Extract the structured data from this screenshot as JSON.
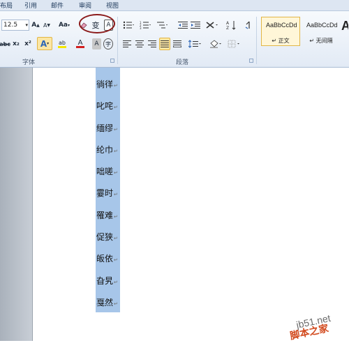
{
  "ribbon_tabs": [
    "布局",
    "引用",
    "邮件",
    "审阅",
    "视图"
  ],
  "font": {
    "size_value": "12.5",
    "grow_label": "A",
    "shrink_label": "A",
    "case_label": "Aa",
    "strike_label": "abc",
    "subscript_label": "x₂",
    "superscript_label": "x²",
    "effects_label": "A",
    "highlight_label": "ab",
    "color_label": "A",
    "shade_label": "A",
    "enclose_label": "字",
    "clear_label": "A",
    "phonetic_label": "变",
    "border_label": "A",
    "group_label": "字体"
  },
  "paragraph": {
    "group_label": "段落"
  },
  "styles": [
    {
      "sample": "AaBbCcDd",
      "name": "↵ 正文"
    },
    {
      "sample": "AaBbCcDd",
      "name": "↵ 无间隔"
    },
    {
      "sample": "A",
      "name": ""
    }
  ],
  "document": {
    "lines": [
      "徜徉",
      "叱咤",
      "缅缪",
      "纶巾",
      "咄嗟",
      "霎时",
      "罹难",
      "促狭",
      "皈依",
      "旮旯",
      "戛然"
    ]
  },
  "watermark": {
    "site": "jb51.net",
    "name": "脚本之家"
  },
  "colors": {
    "selection": "#a7c6e9",
    "circle": "#8b1a1a",
    "font_color_red": "#d21f1f",
    "highlight_yellow": "#f5e600"
  }
}
